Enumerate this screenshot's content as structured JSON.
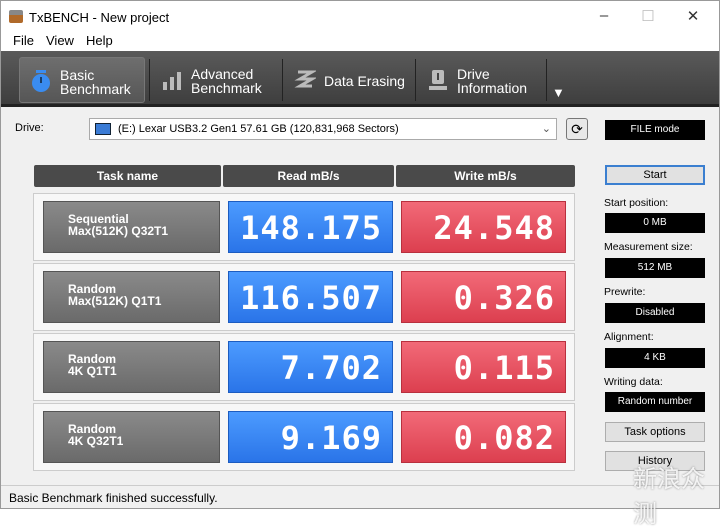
{
  "window": {
    "title": "TxBENCH - New project",
    "controls": [
      "–",
      "☐",
      "✕"
    ]
  },
  "menu": [
    "File",
    "View",
    "Help"
  ],
  "tabs": [
    {
      "label": "Basic\nBenchmark",
      "icon": "stopwatch-icon",
      "active": true
    },
    {
      "label": "Advanced\nBenchmark",
      "icon": "bar-chart-icon"
    },
    {
      "label": "Data Erasing",
      "icon": "eraser-icon"
    },
    {
      "label": "Drive\nInformation",
      "icon": "drive-info-icon"
    }
  ],
  "more_arrow": "▼",
  "drive": {
    "label": "Drive:",
    "value": "(E:) Lexar USB3.2 Gen1  57.61 GB (120,831,968 Sectors)",
    "refresh": "⟳"
  },
  "mode": "FILE mode",
  "table": {
    "headers": [
      "Task name",
      "Read mB/s",
      "Write mB/s"
    ],
    "rows": [
      {
        "task": "Sequential\nMax(512K) Q32T1",
        "read": "148.175",
        "write": "24.548"
      },
      {
        "task": "Random\nMax(512K) Q1T1",
        "read": "116.507",
        "write": "0.326"
      },
      {
        "task": "Random\n4K Q1T1",
        "read": "7.702",
        "write": "0.115"
      },
      {
        "task": "Random\n4K Q32T1",
        "read": "9.169",
        "write": "0.082"
      }
    ]
  },
  "side": {
    "start": "Start",
    "start_position_label": "Start position:",
    "start_position": "0 MB",
    "measurement_size_label": "Measurement size:",
    "measurement_size": "512 MB",
    "prewrite_label": "Prewrite:",
    "prewrite": "Disabled",
    "alignment_label": "Alignment:",
    "alignment": "4 KB",
    "writing_data_label": "Writing data:",
    "writing_data": "Random number",
    "task_options": "Task options",
    "history": "History"
  },
  "status": "Basic Benchmark finished successfully.",
  "watermark": "新浪众测",
  "colors": {
    "read": "#2a74e8",
    "write": "#dc3f4f",
    "toolbar": "#4a4a4a"
  }
}
